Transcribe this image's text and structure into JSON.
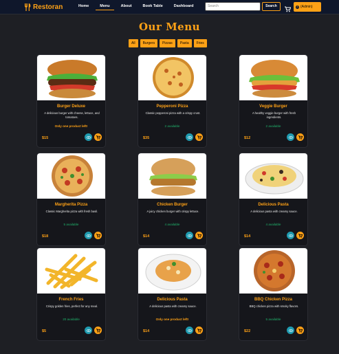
{
  "nav": {
    "brand": "Restoran",
    "links": [
      "Home",
      "Menu",
      "About",
      "Book Table",
      "Dashboard"
    ],
    "search_placeholder": "Search",
    "search_button": "Search",
    "admin_label": "(Admin)",
    "admin_initial": "A"
  },
  "page_title": "Our Menu",
  "filters": [
    "All",
    "Burgers",
    "Pizzas",
    "Pasta",
    "Fries"
  ],
  "items": [
    {
      "name": "Burger Deluxe",
      "desc": "A delicious burger with cheese, lettuce, and tomatoes.",
      "availability": "Only one product left!",
      "price": "$15",
      "image": "burger"
    },
    {
      "name": "Pepperoni Pizza",
      "desc": "Classic pepperoni pizza with a crispy crust.",
      "availability": "2 available",
      "price": "$35",
      "image": "pizza-plain"
    },
    {
      "name": "Veggie Burger",
      "desc": "A healthy veggie burger with fresh ingredients.",
      "availability": "2 available",
      "price": "$12",
      "image": "burger"
    },
    {
      "name": "Margherita Pizza",
      "desc": "Classic Margherita pizza with fresh basil.",
      "availability": "5 available",
      "price": "$18",
      "image": "pizza"
    },
    {
      "name": "Chicken Burger",
      "desc": "A juicy chicken burger with crispy lettuce.",
      "availability": "4 available",
      "price": "$14",
      "image": "chicken-burger"
    },
    {
      "name": "Delicious Pasta",
      "desc": "A delicious pasta with creamy sauce.",
      "availability": "4 available",
      "price": "$14",
      "image": "pasta"
    },
    {
      "name": "French Fries",
      "desc": "Crispy golden fries, perfect for any meal.",
      "availability": "20 available",
      "price": "$5",
      "image": "fries"
    },
    {
      "name": "Delicious Pasta",
      "desc": "A delicious pasta with creamy sauce.",
      "availability": "Only one product left!",
      "price": "$14",
      "image": "pasta-plate"
    },
    {
      "name": "BBQ Chicken Pizza",
      "desc": "BBQ chicken pizza with smoky flavors.",
      "availability": "5 available",
      "price": "$22",
      "image": "pizza"
    }
  ],
  "colors": {
    "accent": "#fea116",
    "navbar": "#0f172b",
    "background": "#1e1f24",
    "card": "#15161b",
    "available": "#20b26b",
    "view_button": "#1f9bb0"
  },
  "icons": {
    "brand": "utensils-icon",
    "cart": "cart-icon",
    "view": "eye-icon",
    "add_to_cart": "cart-icon"
  }
}
